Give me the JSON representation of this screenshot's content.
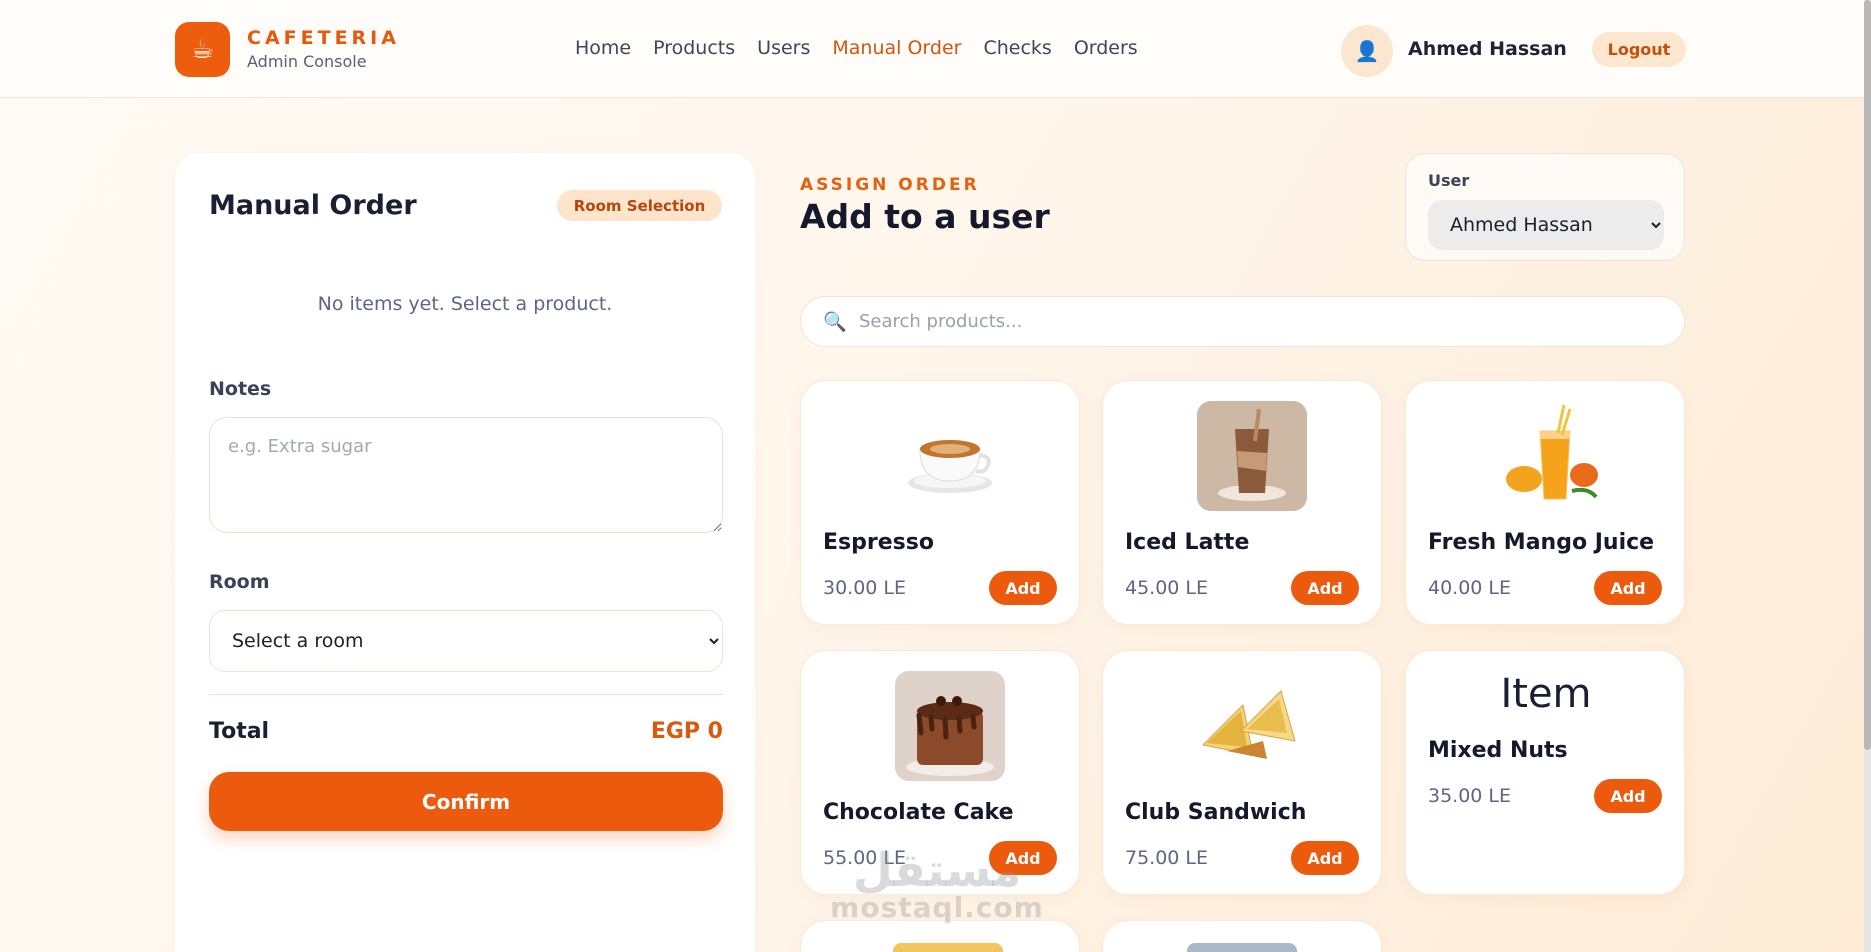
{
  "header": {
    "brand_title": "CAFETERIA",
    "brand_sub": "Admin Console",
    "nav": [
      {
        "label": "Home"
      },
      {
        "label": "Products"
      },
      {
        "label": "Users"
      },
      {
        "label": "Manual Order",
        "active": true
      },
      {
        "label": "Checks"
      },
      {
        "label": "Orders"
      }
    ],
    "user_name": "Ahmed Hassan",
    "logout_label": "Logout"
  },
  "left_panel": {
    "title": "Manual Order",
    "badge": "Room Selection",
    "empty_message": "No items yet. Select a product.",
    "notes_label": "Notes",
    "notes_placeholder": "e.g. Extra sugar",
    "room_label": "Room",
    "room_selected": "Select a room",
    "total_label": "Total",
    "total_value": "EGP 0",
    "confirm_label": "Confirm"
  },
  "assign": {
    "eyebrow": "ASSIGN ORDER",
    "title": "Add to a user",
    "user_label": "User",
    "user_selected": "Ahmed Hassan"
  },
  "search": {
    "placeholder": "Search products..."
  },
  "products": [
    {
      "name": "Espresso",
      "price": "30.00 LE",
      "add": "Add",
      "icon": "coffee-cup-image"
    },
    {
      "name": "Iced Latte",
      "price": "45.00 LE",
      "add": "Add",
      "icon": "iced-latte-image"
    },
    {
      "name": "Fresh Mango Juice",
      "price": "40.00 LE",
      "add": "Add",
      "icon": "mango-juice-image"
    },
    {
      "name": "Chocolate Cake",
      "price": "55.00 LE",
      "add": "Add",
      "icon": "chocolate-cake-image"
    },
    {
      "name": "Club Sandwich",
      "price": "75.00 LE",
      "add": "Add",
      "icon": "sandwich-image"
    },
    {
      "name": "Mixed Nuts",
      "price": "35.00 LE",
      "add": "Add",
      "placeholder_text": "Item"
    }
  ],
  "watermark": {
    "arabic": "مستقل",
    "latin": "mostaql.com"
  },
  "colors": {
    "accent": "#eb5a0d",
    "badge_bg": "#fde4cb"
  }
}
